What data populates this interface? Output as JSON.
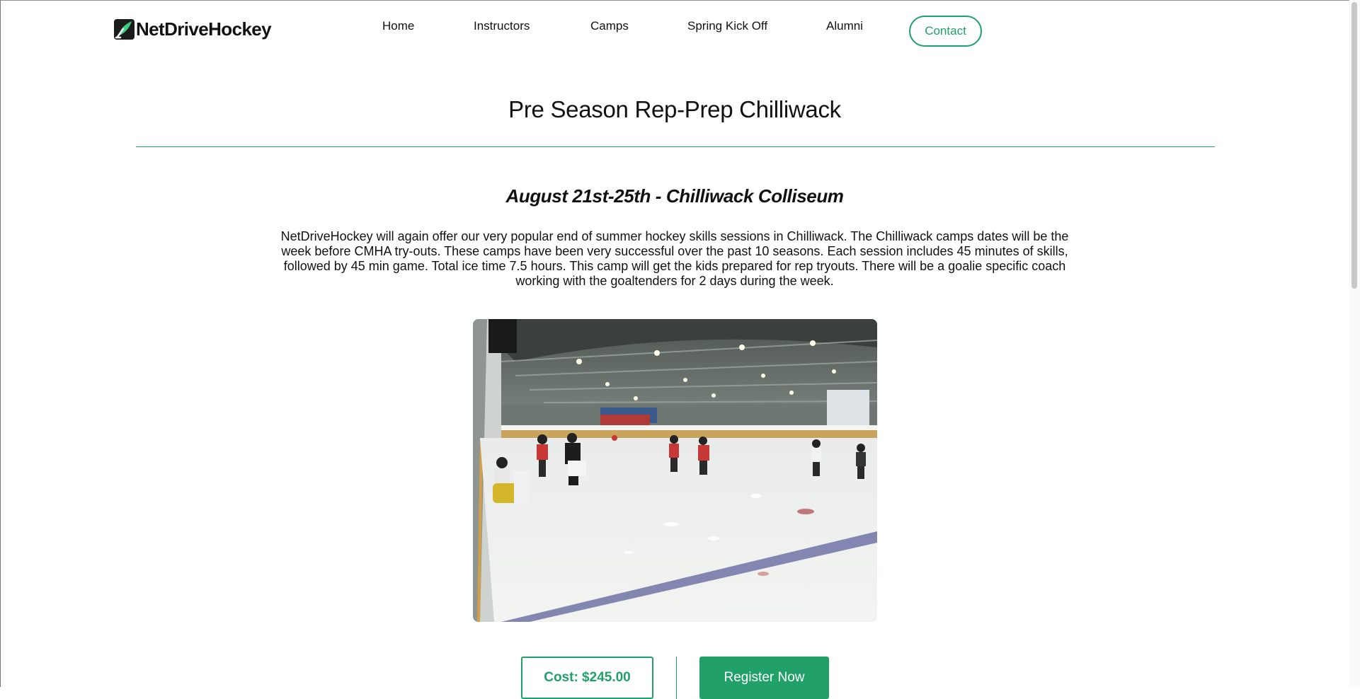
{
  "header": {
    "brand": "NetDriveHockey",
    "nav": [
      {
        "label": "Home"
      },
      {
        "label": "Instructors"
      },
      {
        "label": "Camps"
      },
      {
        "label": "Spring Kick Off"
      },
      {
        "label": "Alumni"
      }
    ],
    "contact_label": "Contact"
  },
  "main": {
    "title": "Pre Season Rep-Prep Chilliwack",
    "subtitle": "August 21st-25th - Chilliwack Colliseum",
    "description": "NetDriveHockey will again offer our very popular end of summer hockey skills sessions in Chilliwack. The Chilliwack camps dates will be the week before CMHA try-outs. These camps have been very successful over the past 10 seasons. Each session includes 45 minutes of skills, followed by 45 min game. Total ice time 7.5 hours. This camp will get the kids prepared for rep tryouts. There will be a goalie specific coach working with the goaltenders for 2 days during the week.",
    "cost_label": "Cost: $245.00",
    "register_label": "Register Now"
  },
  "colors": {
    "accent": "#21a169",
    "text": "#111111",
    "background": "#ffffff"
  },
  "icons": {
    "logo": "hockey-stick-leaf-logo-icon"
  }
}
